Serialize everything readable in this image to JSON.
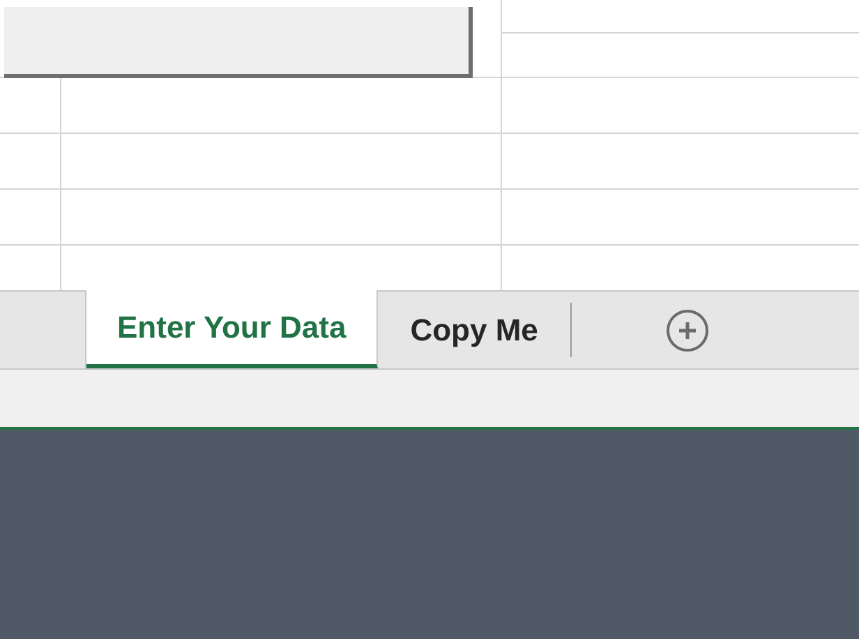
{
  "sheet_tabs": [
    {
      "label": "Enter Your Data",
      "selected": true
    },
    {
      "label": "Copy Me",
      "selected": false
    }
  ]
}
